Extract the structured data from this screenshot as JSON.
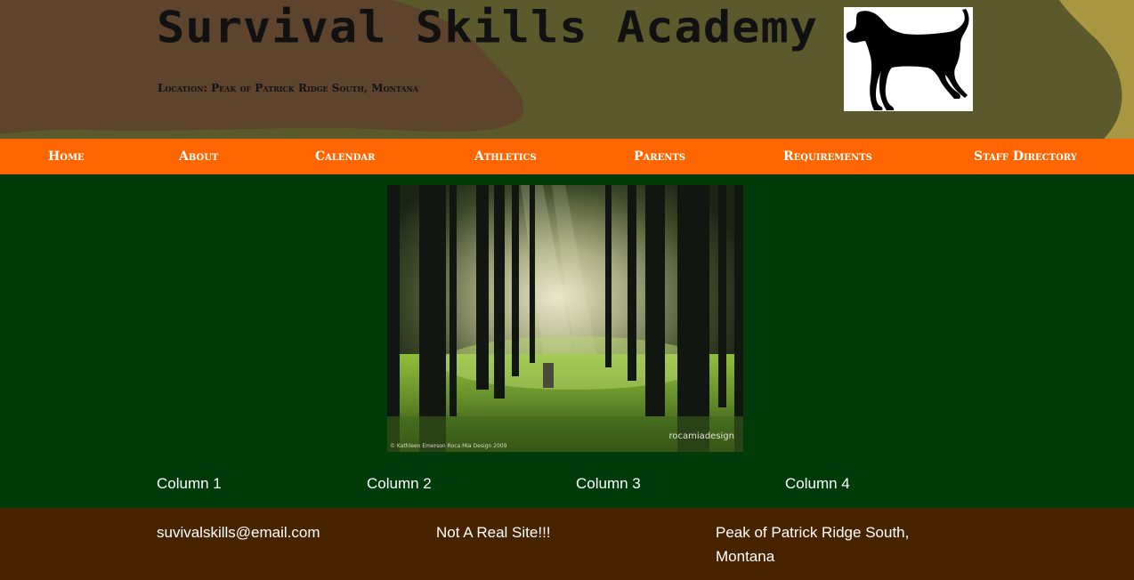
{
  "header": {
    "title": "Survival Skills Academy",
    "location": "Location: Peak of Patrick Ridge South, Montana",
    "logo_icon": "hound-dog-silhouette-icon"
  },
  "nav": {
    "items": [
      {
        "label": "Home"
      },
      {
        "label": "About"
      },
      {
        "label": "Calendar"
      },
      {
        "label": "Athletics"
      },
      {
        "label": "Parents"
      },
      {
        "label": "Requirements"
      },
      {
        "label": "Staff Directory"
      }
    ]
  },
  "hero": {
    "credit": "© Kathleen Emerson Roca Mia Design 2009",
    "brand": "rocamiadesign"
  },
  "columns": [
    {
      "label": "Column 1"
    },
    {
      "label": "Column 2"
    },
    {
      "label": "Column 3"
    },
    {
      "label": "Column 4"
    }
  ],
  "footer": {
    "email": "suvivalskills@email.com",
    "note": "Not A Real Site!!!",
    "address": "Peak of Patrick Ridge South, Montana"
  },
  "colors": {
    "nav_bg": "#ff6600",
    "body_bg": "#003c0a",
    "footer_bg": "#472300",
    "header_olive": "#5c5a2c",
    "header_brown": "#5e442d",
    "header_tan": "#a99640"
  }
}
